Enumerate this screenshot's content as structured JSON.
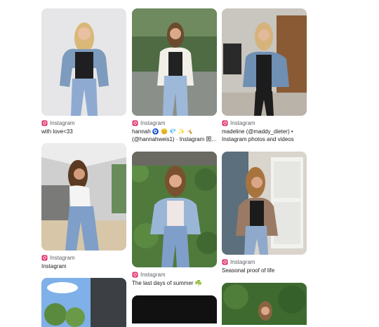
{
  "results": [
    {
      "source": "Instagram",
      "caption": "with love<33"
    },
    {
      "source": "Instagram",
      "caption_line1": "hannah 🧿 😊 💎 ✨ 🤸",
      "caption_line2": "(@hannahweis1) · Instagram 照..."
    },
    {
      "source": "Instagram",
      "caption_line1": "madeline (@maddy_dieter) •",
      "caption_line2": "Instagram photos and videos"
    },
    {
      "source": "Instagram",
      "caption": "Instagram"
    },
    {
      "source": "Instagram",
      "caption": "The last days of summer ☘️"
    },
    {
      "source": "Instagram",
      "caption": "Seasonal proof of life"
    }
  ],
  "colors": {
    "source_text": "#5f6368",
    "caption_text": "#202124",
    "instagram_icon": "#e1306c"
  },
  "icons": {
    "source_logo": "instagram-icon"
  }
}
